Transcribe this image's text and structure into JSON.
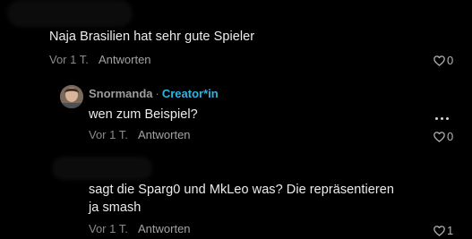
{
  "comments": [
    {
      "text": "Naja Brasilien hat sehr gute Spieler",
      "time": "Vor 1 T.",
      "reply_label": "Antworten",
      "likes": "0"
    },
    {
      "author": "Snormanda",
      "separator": "·",
      "badge": "Creator*in",
      "text": "wen zum Beispiel?",
      "time": "Vor 1 T.",
      "reply_label": "Antworten",
      "likes": "0"
    },
    {
      "text_line1": "sagt die Sparg0 und MkLeo was? Die repräsentieren",
      "text_line2": "ja smash",
      "time": "Vor 1 T.",
      "reply_label": "Antworten",
      "likes": "1"
    }
  ],
  "colors": {
    "background": "#000000",
    "text": "#ececec",
    "meta": "#8a8a8a",
    "creator_badge": "#2ab7e6"
  },
  "icons": {
    "like": "heart-outline-icon",
    "more": "more-horizontal-icon"
  }
}
